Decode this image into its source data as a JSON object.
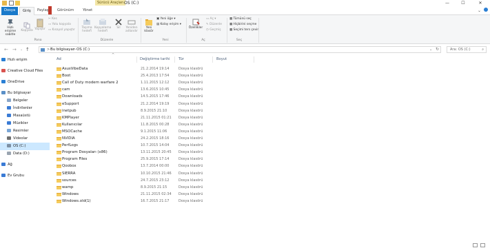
{
  "titlebar": {
    "context_tab": "Sürücü Araçları",
    "title": "OS (C:)",
    "minimize": "—",
    "maximize": "☐",
    "close": "✕"
  },
  "tabs": {
    "file": "Dosya",
    "home": "Giriş",
    "share": "Paylaş",
    "view": "Görünüm",
    "manage": "Yönet"
  },
  "ribbon": {
    "pin": "Hızlı erişime sabitle",
    "copy": "Kopyala",
    "paste": "Yapıştır",
    "cut": "Kes",
    "copy_path": "Yolu kopyala",
    "paste_shortcut": "Kısayol yapıştır",
    "group_clipboard": "Pano",
    "move_to": "Taşıma hedefi",
    "copy_to": "Kopyalama hedefi",
    "delete": "Sil",
    "rename": "Yeniden adlandır",
    "group_organize": "Düzenle",
    "new_folder": "Yeni klasör",
    "new_item": "Yeni öğe",
    "easy_access": "Kolay erişim",
    "group_new": "Yeni",
    "properties": "Özellikler",
    "open": "Aç",
    "edit": "Düzenle",
    "history": "Geçmiş",
    "group_open": "Aç",
    "select_all": "Tümünü seç",
    "select_none": "Hiçbirini seçme",
    "invert_selection": "Seçimi ters çevir",
    "group_select": "Seç"
  },
  "address": {
    "back": "←",
    "forward": "→",
    "up": "↑",
    "crumbs": [
      "Bu bilgisayar",
      "OS (C:)"
    ],
    "crumb_sep": ">",
    "search_placeholder": "Ara: OS (C:)"
  },
  "navpane": [
    {
      "label": "Hızlı erişim",
      "icon": "star-icon",
      "color": "#2a7fd4"
    },
    {
      "label": "Creative Cloud Files",
      "icon": "cloud-icon",
      "color": "#d9534f"
    },
    {
      "label": "OneDrive",
      "icon": "onedrive-icon",
      "color": "#2a7fd4"
    },
    {
      "label": "Bu bilgisayar",
      "icon": "computer-icon",
      "color": "#5a8fc7"
    },
    {
      "label": "Belgeler",
      "icon": "documents-icon",
      "color": "#8aa6c8"
    },
    {
      "label": "İndirilenler",
      "icon": "downloads-icon",
      "color": "#3a7bd5"
    },
    {
      "label": "Masaüstü",
      "icon": "desktop-icon",
      "color": "#3a7bd5"
    },
    {
      "label": "Müzikler",
      "icon": "music-icon",
      "color": "#3a7bd5"
    },
    {
      "label": "Resimler",
      "icon": "pictures-icon",
      "color": "#7aa6d6"
    },
    {
      "label": "Videolar",
      "icon": "videos-icon",
      "color": "#6f6f6f"
    },
    {
      "label": "OS (C:)",
      "icon": "drive-icon",
      "color": "#7d8fa3"
    },
    {
      "label": "Data (D:)",
      "icon": "drive-icon",
      "color": "#9aa5b1"
    },
    {
      "label": "Ağ",
      "icon": "network-icon",
      "color": "#3a7bd5"
    },
    {
      "label": "Ev Grubu",
      "icon": "homegroup-icon",
      "color": "#3a7bd5"
    }
  ],
  "columns": {
    "name": "Ad",
    "date": "Değiştirme tarihi",
    "type": "Tür",
    "size": "Boyut"
  },
  "files": [
    {
      "name": "AsusVibeData",
      "date": "21.2.2014 19:14",
      "type": "Dosya klasörü"
    },
    {
      "name": "Boot",
      "date": "25.4.2013 17:54",
      "type": "Dosya klasörü"
    },
    {
      "name": "Call of Duty modern warfare 2",
      "date": "1.11.2015 12:12",
      "type": "Dosya klasörü"
    },
    {
      "name": "cam",
      "date": "13.6.2015 10:45",
      "type": "Dosya klasörü"
    },
    {
      "name": "Downloads",
      "date": "14.5.2015 17:46",
      "type": "Dosya klasörü"
    },
    {
      "name": "eSupport",
      "date": "21.2.2014 19:19",
      "type": "Dosya klasörü"
    },
    {
      "name": "inetpub",
      "date": "8.9.2015 21:10",
      "type": "Dosya klasörü"
    },
    {
      "name": "KMPlayer",
      "date": "21.11.2015 01:21",
      "type": "Dosya klasörü"
    },
    {
      "name": "Kullanıcılar",
      "date": "11.8.2015 00:28",
      "type": "Dosya klasörü"
    },
    {
      "name": "MSOCache",
      "date": "9.1.2015 11:06",
      "type": "Dosya klasörü"
    },
    {
      "name": "NVIDIA",
      "date": "24.2.2015 18:16",
      "type": "Dosya klasörü"
    },
    {
      "name": "PerfLogs",
      "date": "10.7.2015 14:04",
      "type": "Dosya klasörü"
    },
    {
      "name": "Program Dosyaları (x86)",
      "date": "13.11.2015 20:45",
      "type": "Dosya klasörü"
    },
    {
      "name": "Program Files",
      "date": "25.9.2015 17:14",
      "type": "Dosya klasörü"
    },
    {
      "name": "Qoobox",
      "date": "13.7.2014 00:00",
      "type": "Dosya klasörü"
    },
    {
      "name": "SIERRA",
      "date": "10.10.2015 21:46",
      "type": "Dosya klasörü"
    },
    {
      "name": "sources",
      "date": "24.7.2015 23:12",
      "type": "Dosya klasörü"
    },
    {
      "name": "wamp",
      "date": "8.9.2015 21:15",
      "type": "Dosya klasörü"
    },
    {
      "name": "Windows",
      "date": "21.11.2015 02:34",
      "type": "Dosya klasörü"
    },
    {
      "name": "Windows.old(1)",
      "date": "16.7.2015 21:17",
      "type": "Dosya klasörü"
    }
  ]
}
